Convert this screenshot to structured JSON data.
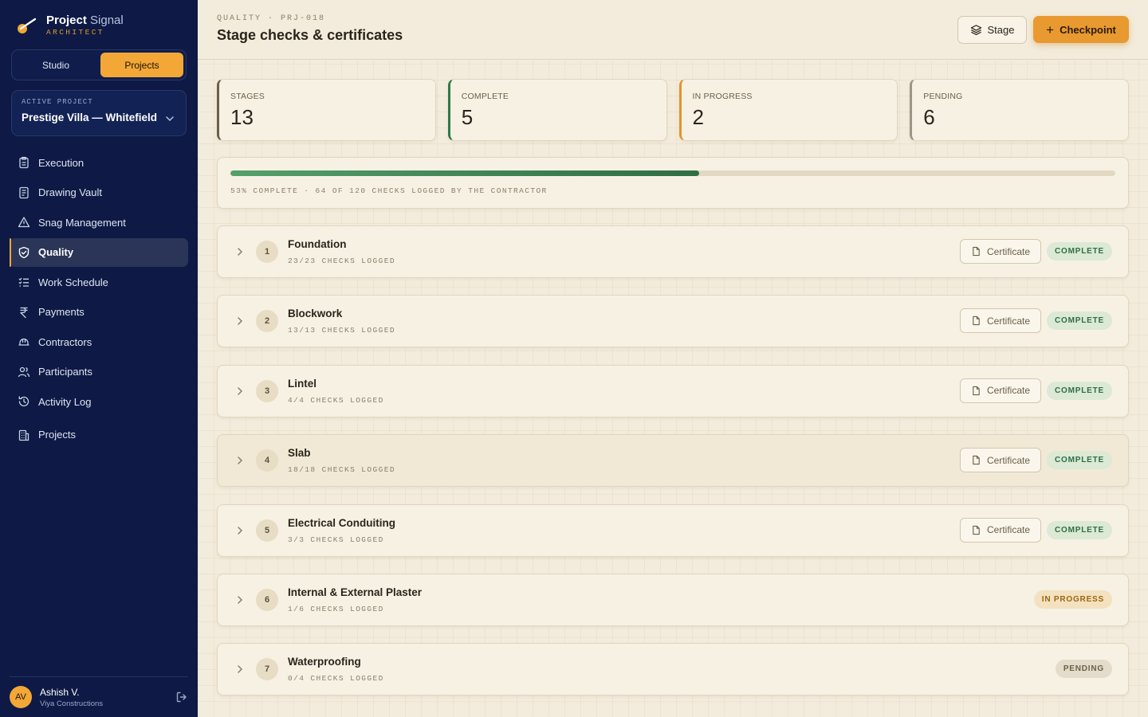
{
  "brand": {
    "title_bold": "Project",
    "title_light": "Signal",
    "subtitle": "ARCHITECT"
  },
  "mode_switch": {
    "studio": "Studio",
    "projects": "Projects"
  },
  "active_project": {
    "label": "ACTIVE PROJECT",
    "name": "Prestige Villa — Whitefield"
  },
  "nav": [
    {
      "label": "Execution",
      "icon": "clipboard-icon"
    },
    {
      "label": "Drawing Vault",
      "icon": "document-icon"
    },
    {
      "label": "Snag Management",
      "icon": "warning-triangle-icon"
    },
    {
      "label": "Quality",
      "icon": "shield-check-icon",
      "active": true
    },
    {
      "label": "Work Schedule",
      "icon": "checklist-icon"
    },
    {
      "label": "Payments",
      "icon": "rupee-icon"
    },
    {
      "label": "Contractors",
      "icon": "hard-hat-icon"
    },
    {
      "label": "Participants",
      "icon": "users-icon"
    },
    {
      "label": "Activity Log",
      "icon": "history-icon"
    },
    {
      "label": "Projects",
      "icon": "building-icon"
    }
  ],
  "user": {
    "initials": "AV",
    "name": "Ashish V.",
    "org": "Viya Constructions"
  },
  "header": {
    "breadcrumb": "QUALITY · PRJ-018",
    "title": "Stage checks & certificates",
    "stage_button": "Stage",
    "checkpoint_button": "Checkpoint"
  },
  "stats": [
    {
      "label": "STAGES",
      "value": "13"
    },
    {
      "label": "COMPLETE",
      "value": "5"
    },
    {
      "label": "IN PROGRESS",
      "value": "2"
    },
    {
      "label": "PENDING",
      "value": "6"
    }
  ],
  "progress": {
    "percent": 53,
    "caption": "53% COMPLETE · 64 OF 120 CHECKS LOGGED BY THE CONTRACTOR"
  },
  "certificate_label": "Certificate",
  "stages": [
    {
      "num": "1",
      "name": "Foundation",
      "checks": "23/23 CHECKS LOGGED",
      "status": "COMPLETE",
      "state": "complete"
    },
    {
      "num": "2",
      "name": "Blockwork",
      "checks": "13/13 CHECKS LOGGED",
      "status": "COMPLETE",
      "state": "complete"
    },
    {
      "num": "3",
      "name": "Lintel",
      "checks": "4/4 CHECKS LOGGED",
      "status": "COMPLETE",
      "state": "complete"
    },
    {
      "num": "4",
      "name": "Slab",
      "checks": "18/18 CHECKS LOGGED",
      "status": "COMPLETE",
      "state": "complete"
    },
    {
      "num": "5",
      "name": "Electrical Conduiting",
      "checks": "3/3 CHECKS LOGGED",
      "status": "COMPLETE",
      "state": "complete"
    },
    {
      "num": "6",
      "name": "Internal & External Plaster",
      "checks": "1/6 CHECKS LOGGED",
      "status": "IN PROGRESS",
      "state": "progress"
    },
    {
      "num": "7",
      "name": "Waterproofing",
      "checks": "0/4 CHECKS LOGGED",
      "status": "PENDING",
      "state": "pending"
    }
  ],
  "colors": {
    "sidebar": "#0e1a45",
    "accent": "#f2a737",
    "complete": "#2f6e43",
    "background": "#f3ecdc"
  }
}
